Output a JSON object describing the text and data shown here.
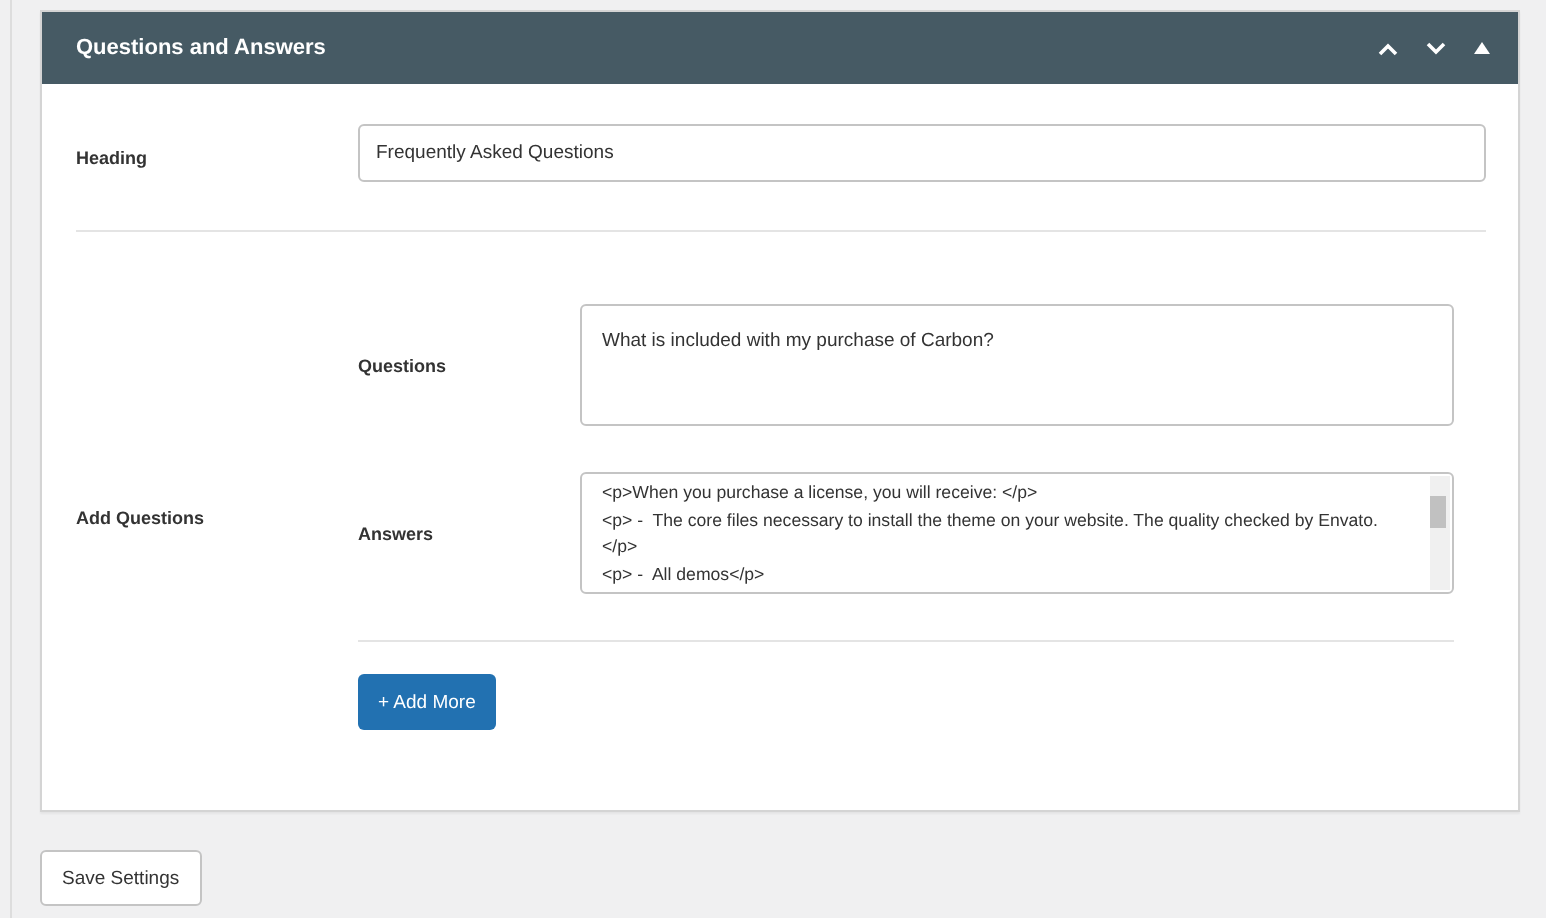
{
  "panel": {
    "title": "Questions and Answers",
    "heading": {
      "label": "Heading",
      "value": "Frequently Asked Questions"
    },
    "add_questions": {
      "label": "Add Questions",
      "items": [
        {
          "label": "Questions",
          "value": "What is included with my purchase of Carbon?"
        },
        {
          "label": "Answers",
          "value": "<p>When you purchase a license, you will receive: </p>\n<p> -  The core files necessary to install the theme on your website. The quality checked by Envato.\n</p>\n<p> -  All demos</p>"
        }
      ],
      "add_button": "+ Add More"
    }
  },
  "save_button": "Save Settings"
}
